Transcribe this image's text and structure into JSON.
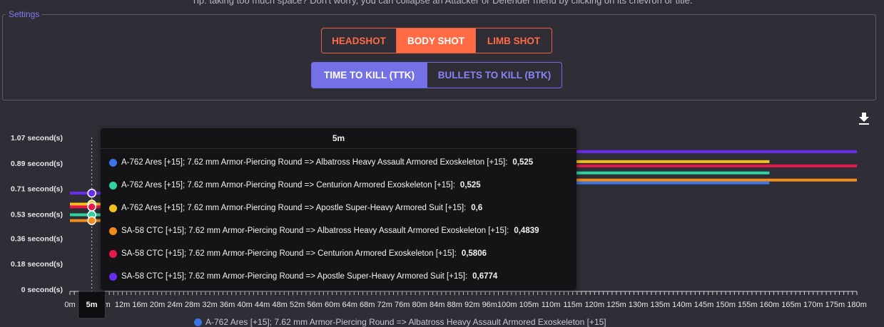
{
  "tip": "Tip: taking too much space? Don't worry, you can collapse an Attacker or Defender menu by clicking on its chevron or title.",
  "settings": {
    "legend": "Settings",
    "shot_buttons": [
      "HEADSHOT",
      "BODY SHOT",
      "LIMB SHOT"
    ],
    "shot_active": "BODY SHOT",
    "mode_buttons": [
      "TIME TO KILL (TTK)",
      "BULLETS TO KILL (BTK)"
    ],
    "mode_active": "TIME TO KILL (TTK)"
  },
  "download_icon": "download-icon",
  "tooltip": {
    "header": "5m",
    "rows": [
      {
        "label": "A-762 Ares [+15]; 7.62 mm Armor-Piercing Round => Albatross Heavy Assault Armored Exoskeleton [+15]:",
        "value": "0,525",
        "color": "#3b74e6"
      },
      {
        "label": "A-762 Ares [+15]; 7.62 mm Armor-Piercing Round => Centurion Armored Exoskeleton [+15]:",
        "value": "0,525",
        "color": "#2bd4a0"
      },
      {
        "label": "A-762 Ares [+15]; 7.62 mm Armor-Piercing Round => Apostle Super-Heavy Armored Suit [+15]:",
        "value": "0,6",
        "color": "#f5c01a"
      },
      {
        "label": "SA-58 CTC [+15]; 7.62 mm Armor-Piercing Round => Albatross Heavy Assault Armored Exoskeleton [+15]:",
        "value": "0,4839",
        "color": "#f28c1a"
      },
      {
        "label": "SA-58 CTC [+15]; 7.62 mm Armor-Piercing Round => Centurion Armored Exoskeleton [+15]:",
        "value": "0,5806",
        "color": "#e8194a"
      },
      {
        "label": "SA-58 CTC [+15]; 7.62 mm Armor-Piercing Round => Apostle Super-Heavy Armored Suit [+15]:",
        "value": "0,6774",
        "color": "#6a2cf0"
      }
    ]
  },
  "bottom_legend": "A-762 Ares [+15]; 7.62 mm Armor-Piercing Round => Albatross Heavy Assault Armored Exoskeleton [+15]",
  "chart_data": {
    "type": "line",
    "ylim": [
      0,
      1.07
    ],
    "y_ticks": [
      0,
      0.18,
      0.36,
      0.53,
      0.71,
      0.89,
      1.07
    ],
    "y_tick_labels": [
      "0 second(s)",
      "0.18 second(s)",
      "0.36 second(s)",
      "0.53 second(s)",
      "0.71 second(s)",
      "0.89 second(s)",
      "1.07 second(s)"
    ],
    "x": [
      0,
      1,
      2,
      3,
      4,
      5,
      6,
      7,
      8,
      9,
      10,
      11,
      12,
      13,
      14,
      15,
      16,
      17,
      18,
      19,
      20,
      21,
      22,
      23,
      24,
      25,
      26,
      27,
      28,
      29,
      30,
      31,
      32,
      33,
      34,
      35,
      36,
      37,
      38,
      39,
      40,
      41,
      42,
      43,
      44,
      45,
      46,
      47,
      48,
      49,
      50,
      51,
      52,
      53,
      54,
      55,
      56,
      57,
      58,
      59,
      60,
      61,
      62,
      63,
      64,
      65,
      66,
      67,
      68,
      69,
      70,
      71,
      72,
      73,
      74,
      75,
      76,
      77,
      78,
      79,
      80,
      81,
      82,
      83,
      84,
      85,
      86,
      87,
      88,
      89,
      90,
      91,
      92,
      93,
      94,
      95,
      96,
      97,
      98,
      99,
      100,
      101,
      102,
      103,
      104,
      105,
      106,
      107,
      108,
      109,
      110,
      111,
      112,
      113,
      114,
      115,
      116,
      117,
      118,
      119,
      120,
      121,
      122,
      123,
      124,
      125,
      126,
      127,
      128,
      129,
      130,
      131,
      132,
      133,
      134,
      135,
      136,
      137,
      138,
      139,
      140,
      141,
      142,
      143,
      144,
      145,
      146,
      147,
      148,
      149,
      150,
      151,
      152,
      153,
      154,
      155,
      156,
      157,
      158,
      159,
      160,
      161,
      162,
      163,
      164,
      165,
      166,
      167,
      168,
      169,
      170,
      171,
      172,
      173,
      174,
      175,
      176,
      177,
      178,
      179,
      180
    ],
    "x_tick_labels": [
      "0m",
      "4m",
      "8m",
      "12m",
      "16m",
      "20m",
      "24m",
      "28m",
      "32m",
      "36m",
      "40m",
      "44m",
      "48m",
      "52m",
      "56m",
      "60m",
      "64m",
      "68m",
      "72m",
      "76m",
      "80m",
      "84m",
      "88m",
      "92m",
      "96m",
      "100m",
      "105m",
      "110m",
      "115m",
      "120m",
      "125m",
      "130m",
      "135m",
      "140m",
      "145m",
      "150m",
      "155m",
      "160m",
      "165m",
      "170m",
      "175m",
      "180m"
    ],
    "x_tick_values": [
      0,
      4,
      8,
      12,
      16,
      20,
      24,
      28,
      32,
      36,
      40,
      44,
      48,
      52,
      56,
      60,
      64,
      68,
      72,
      76,
      80,
      84,
      88,
      92,
      96,
      100,
      105,
      110,
      115,
      120,
      125,
      130,
      135,
      140,
      145,
      150,
      155,
      160,
      165,
      170,
      175,
      180
    ],
    "highlight_x": 5,
    "highlight_label": "5m",
    "series": [
      {
        "name": "A-762 Ares [+15]; 7.62 mm Armor-Piercing Round => Albatross Heavy Assault Armored Exoskeleton [+15]",
        "color": "#3b74e6",
        "steps": [
          [
            0,
            0.525
          ],
          [
            30,
            0.56
          ],
          [
            50,
            0.6
          ],
          [
            65,
            0.65
          ],
          [
            80,
            0.75
          ]
        ],
        "end": 160
      },
      {
        "name": "A-762 Ares [+15]; 7.62 mm Armor-Piercing Round => Centurion Armored Exoskeleton [+15]",
        "color": "#2bd4a0",
        "steps": [
          [
            0,
            0.525
          ],
          [
            30,
            0.6
          ],
          [
            50,
            0.7
          ],
          [
            65,
            0.82
          ]
        ],
        "end": 160
      },
      {
        "name": "A-762 Ares [+15]; 7.62 mm Armor-Piercing Round => Apostle Super-Heavy Armored Suit [+15]",
        "color": "#f5c01a",
        "steps": [
          [
            0,
            0.6
          ],
          [
            30,
            0.67
          ],
          [
            50,
            0.75
          ],
          [
            65,
            0.9
          ]
        ],
        "end": 160
      },
      {
        "name": "SA-58 CTC [+15]; 7.62 mm Armor-Piercing Round => Albatross Heavy Assault Armored Exoskeleton [+15]",
        "color": "#f28c1a",
        "steps": [
          [
            0,
            0.4839
          ],
          [
            30,
            0.55
          ],
          [
            50,
            0.63
          ],
          [
            65,
            0.7
          ],
          [
            80,
            0.77
          ]
        ],
        "end": 180
      },
      {
        "name": "SA-58 CTC [+15]; 7.62 mm Armor-Piercing Round => Centurion Armored Exoskeleton [+15]",
        "color": "#e8194a",
        "steps": [
          [
            0,
            0.5806
          ],
          [
            30,
            0.66
          ],
          [
            50,
            0.75
          ],
          [
            65,
            0.87
          ]
        ],
        "end": 180
      },
      {
        "name": "SA-58 CTC [+15]; 7.62 mm Armor-Piercing Round => Apostle Super-Heavy Armored Suit [+15]",
        "color": "#6a2cf0",
        "steps": [
          [
            0,
            0.6774
          ],
          [
            30,
            0.76
          ],
          [
            50,
            0.86
          ],
          [
            65,
            0.97
          ]
        ],
        "end": 180
      }
    ]
  }
}
